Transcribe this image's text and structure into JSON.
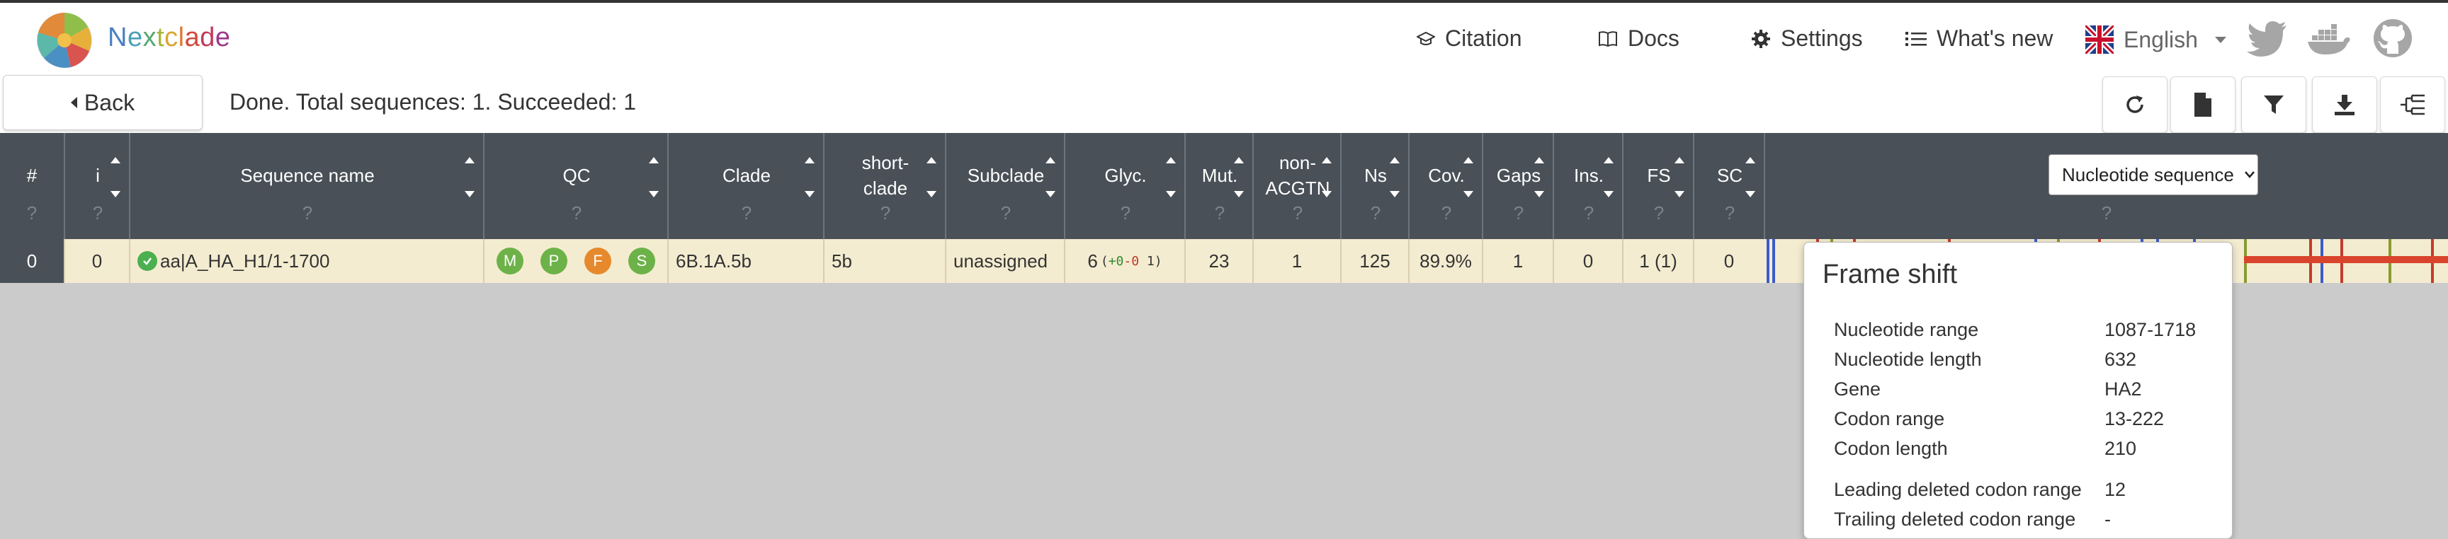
{
  "app": {
    "brand_letters": [
      "N",
      "e",
      "x",
      "t",
      "c",
      "l",
      "a",
      "d",
      "e"
    ],
    "brand_colors": [
      "#4a80c2",
      "#4aa0b8",
      "#55a870",
      "#a9b43c",
      "#d9a635",
      "#e07a38",
      "#d14a3c",
      "#c03a5c",
      "#9a3a8a"
    ]
  },
  "nav": {
    "citation": "Citation",
    "docs": "Docs",
    "settings": "Settings",
    "whats_new": "What's new",
    "language": "English"
  },
  "toolbar": {
    "back_label": "Back",
    "status": "Done. Total sequences: 1. Succeeded: 1"
  },
  "columns": {
    "hash": "#",
    "i": "i",
    "sequence_name": "Sequence name",
    "qc": "QC",
    "clade": "Clade",
    "short_clade": "short-\nclade",
    "subclade": "Subclade",
    "glyc": "Glyc.",
    "mut": "Mut.",
    "non_acgtn": "non-\nACGTN",
    "ns": "Ns",
    "cov": "Cov.",
    "gaps": "Gaps",
    "ins": "Ins.",
    "fs": "FS",
    "sc": "SC",
    "help": "?"
  },
  "view_select": {
    "selected": "Nucleotide sequence"
  },
  "row": {
    "index": "0",
    "i": "0",
    "sequence_name": "aa|A_HA_H1/1-1700",
    "qc": [
      {
        "letter": "M",
        "color": "#6cb248"
      },
      {
        "letter": "P",
        "color": "#6cb248"
      },
      {
        "letter": "F",
        "color": "#e6892c"
      },
      {
        "letter": "S",
        "color": "#6cb248"
      }
    ],
    "clade": "6B.1A.5b",
    "short_clade": "5b",
    "subclade": "unassigned",
    "glyc": "6",
    "glyc_detail": {
      "open": "(",
      "plus": "+0",
      "minus": "-0",
      "rest": " 1)"
    },
    "mut": "23",
    "non_acgtn": "1",
    "ns": "125",
    "cov": "89.9%",
    "gaps": "1",
    "ins": "0",
    "fs": "1 (1)",
    "sc": "0"
  },
  "tooltip": {
    "title": "Frame shift",
    "rows": [
      {
        "label": "Nucleotide range",
        "value": "1087-1718"
      },
      {
        "label": "Nucleotide length",
        "value": "632"
      },
      {
        "label": "Gene",
        "value": "HA2"
      },
      {
        "label": "Codon range",
        "value": "13-222"
      },
      {
        "label": "Codon length",
        "value": "210"
      },
      {
        "label": "Leading deleted codon range",
        "value": "12"
      },
      {
        "label": "Trailing deleted codon range",
        "value": "-"
      }
    ]
  }
}
